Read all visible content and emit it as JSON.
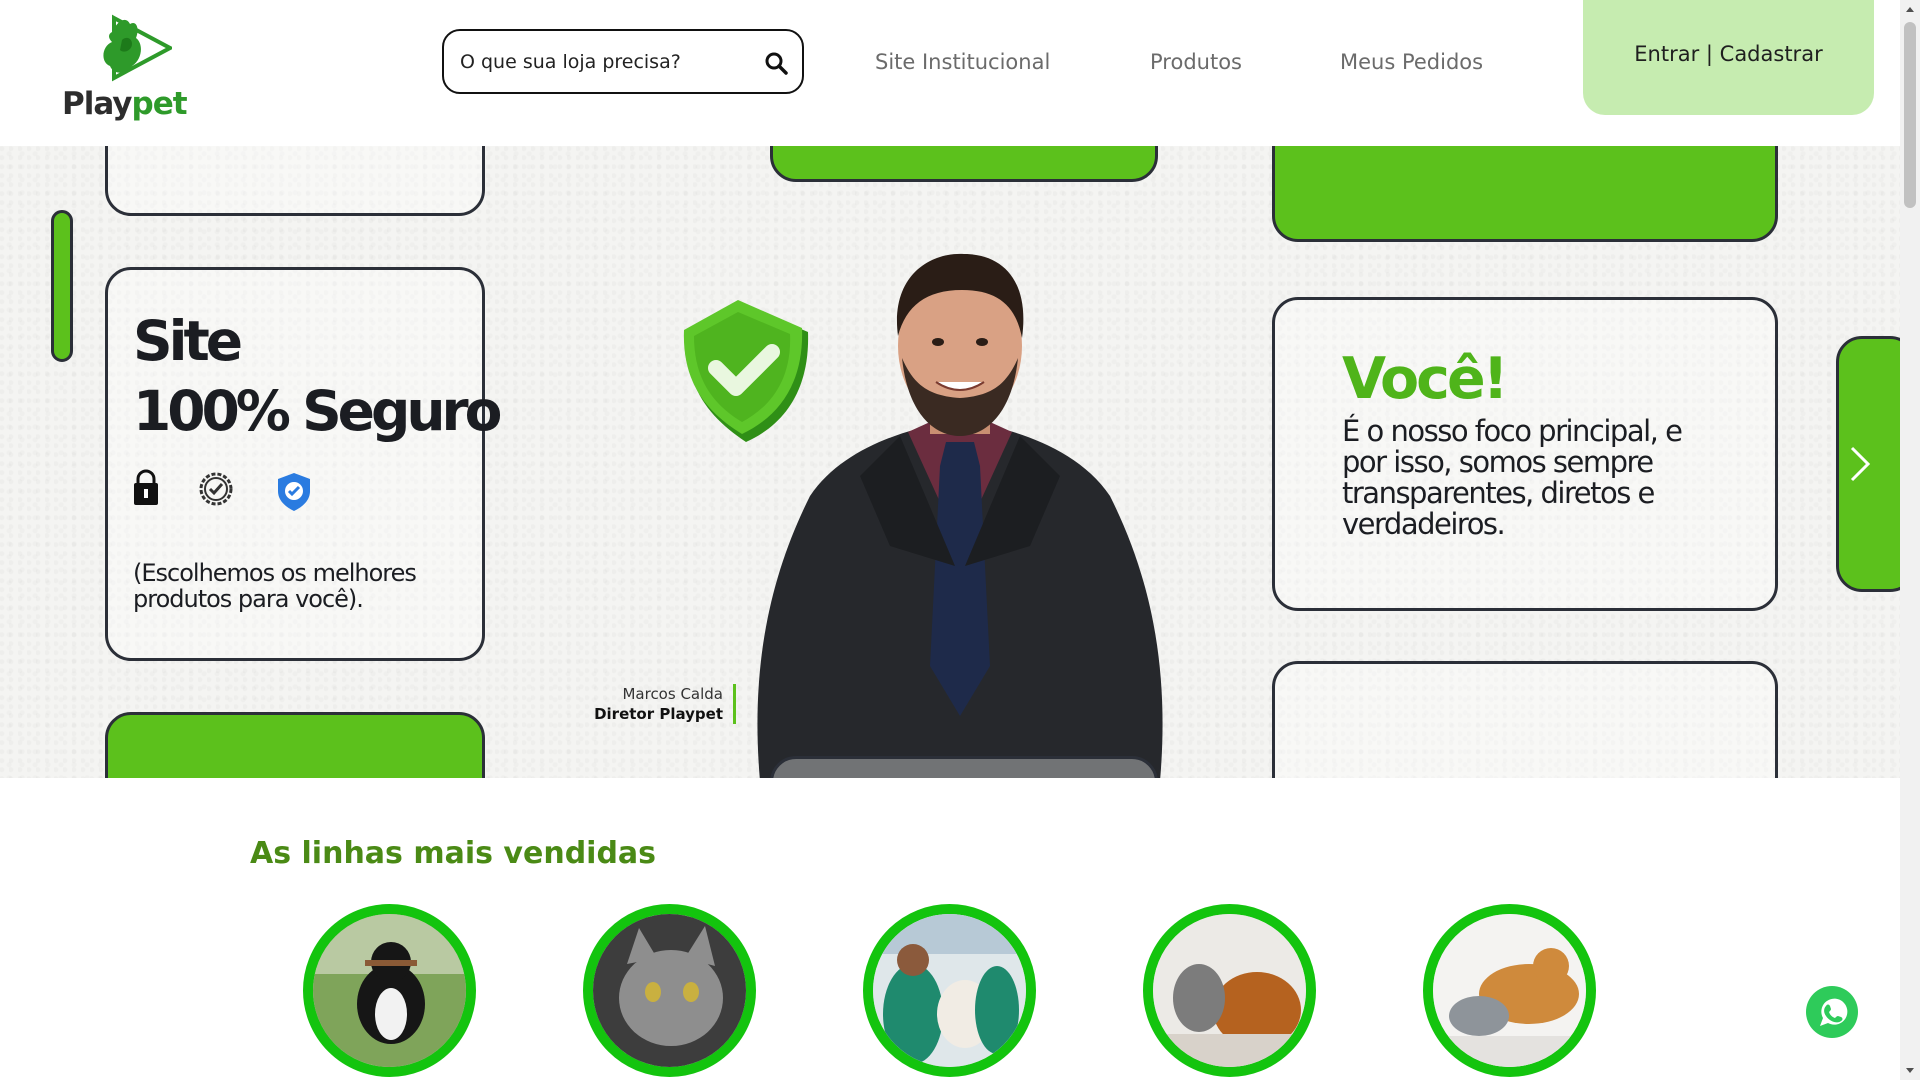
{
  "header": {
    "logo_text_play": "Play",
    "logo_text_pet": "pet",
    "search": {
      "placeholder": "O que sua loja precisa?"
    },
    "nav": [
      {
        "label": "Site Institucional"
      },
      {
        "label": "Produtos"
      },
      {
        "label": "Meus Pedidos"
      }
    ],
    "login_label": "Entrar | Cadastrar"
  },
  "hero": {
    "secure_title_line1": "Site",
    "secure_title_line2": "100% Seguro",
    "secure_subtitle": "(Escolhemos os melhores produtos para você).",
    "voce_title": "Você!",
    "voce_text": "É o nosso foco principal, e por isso, somos sempre transparentes, diretos e verdadeiros.",
    "signature_name": "Marcos Calda",
    "signature_role": "Diretor Playpet"
  },
  "best_sellers": {
    "title": "As linhas mais vendidas",
    "categories": [
      {
        "icon": "dog-running"
      },
      {
        "icon": "cat"
      },
      {
        "icon": "vet-with-dog"
      },
      {
        "icon": "cat-and-dog"
      },
      {
        "icon": "dog-and-cat-lying"
      }
    ]
  },
  "colors": {
    "brand_green": "#5cc11c",
    "title_green": "#4a8a15",
    "login_bg": "#c6ecb0",
    "ring_green": "#13c40e"
  }
}
